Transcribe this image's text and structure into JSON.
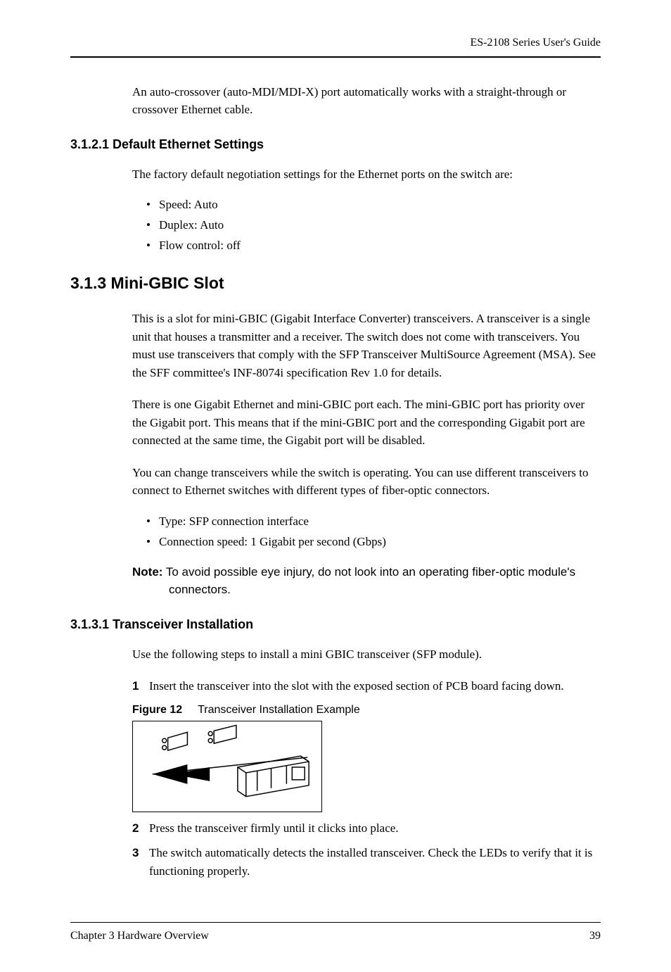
{
  "header": {
    "title": "ES-2108 Series User's Guide"
  },
  "paragraphs": {
    "intro": "An auto-crossover (auto-MDI/MDI-X) port automatically works with a straight-through or crossover Ethernet cable.",
    "defaults_intro": "The factory default negotiation settings for the Ethernet ports on the switch are:",
    "minigbic_p1": "This is a slot for mini-GBIC (Gigabit Interface Converter) transceivers. A transceiver is a single unit that houses a transmitter and a receiver. The switch does not come with transceivers. You must use transceivers that comply with the SFP Transceiver MultiSource Agreement (MSA). See the SFF committee's INF-8074i specification Rev 1.0 for details.",
    "minigbic_p2": "There is one Gigabit Ethernet and mini-GBIC port each. The mini-GBIC port has priority over the Gigabit port. This means that if the mini-GBIC port and the corresponding Gigabit port are connected at the same time, the Gigabit port will be disabled.",
    "minigbic_p3": "You can change transceivers while the switch is operating. You can use different transceivers to connect to Ethernet switches with different types of fiber-optic connectors.",
    "transceiver_intro": "Use the following steps to install a mini GBIC transceiver (SFP module)."
  },
  "headings": {
    "h3_defaults": "3.1.2.1  Default Ethernet Settings",
    "h2_minigbic": "3.1.3  Mini-GBIC Slot",
    "h3_transceiver": "3.1.3.1  Transceiver Installation"
  },
  "lists": {
    "defaults": [
      "Speed: Auto",
      "Duplex: Auto",
      "Flow control: off"
    ],
    "minigbic_specs": [
      "Type: SFP connection interface",
      "Connection speed: 1 Gigabit per second (Gbps)"
    ],
    "steps": [
      "Insert the transceiver into the slot with the exposed section of PCB board facing down.",
      "Press the transceiver firmly until it clicks into place.",
      "The switch automatically detects the installed transceiver. Check the LEDs to verify that it is functioning properly."
    ]
  },
  "note": {
    "label": "Note:",
    "text": "To avoid possible eye injury, do not look into an operating fiber-optic module's connectors."
  },
  "figure": {
    "label": "Figure 12",
    "caption": "Transceiver Installation Example"
  },
  "footer": {
    "chapter": "Chapter 3 Hardware Overview",
    "page": "39"
  }
}
